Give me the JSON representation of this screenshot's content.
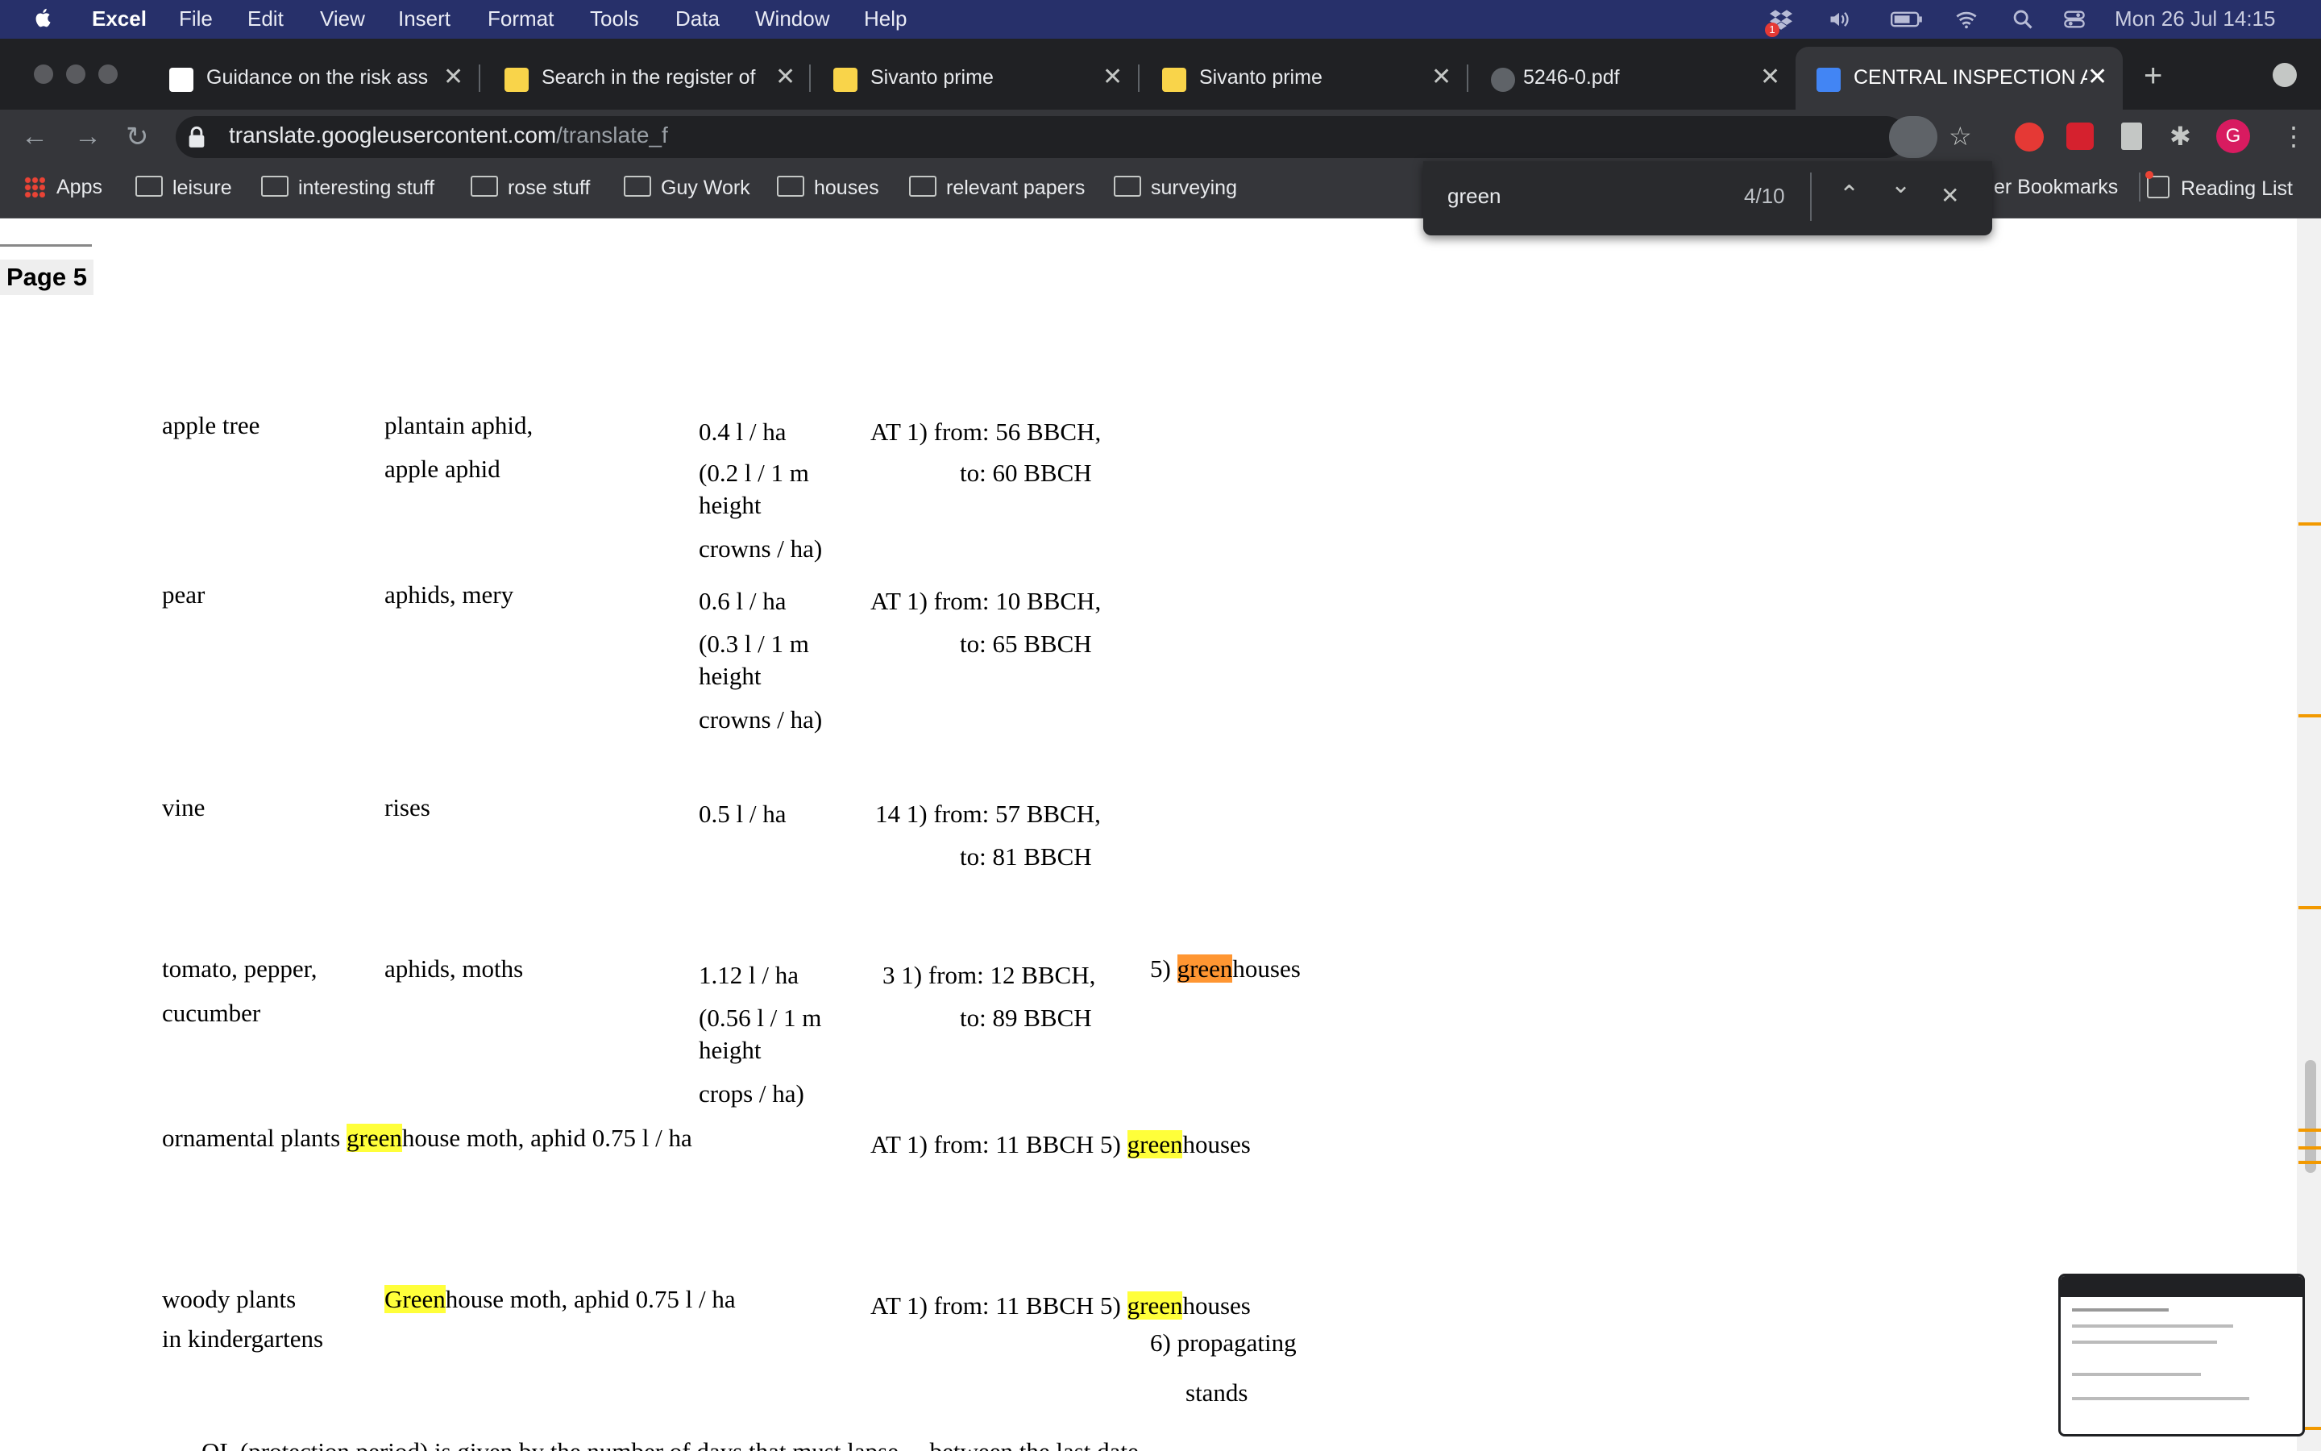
{
  "menubar": {
    "app": "Excel",
    "items": [
      "File",
      "Edit",
      "View",
      "Insert",
      "Format",
      "Tools",
      "Data",
      "Window",
      "Help"
    ],
    "clock": "Mon 26 Jul  14:15",
    "notification_badge": "1"
  },
  "tabs": [
    {
      "title": "Guidance on the risk ass",
      "active": false
    },
    {
      "title": "Search in the register of",
      "active": false
    },
    {
      "title": "Sivanto prime",
      "active": false
    },
    {
      "title": "Sivanto prime",
      "active": false
    },
    {
      "title": "5246-0.pdf",
      "active": false
    },
    {
      "title": "CENTRAL INSPECTION A",
      "active": true
    }
  ],
  "address": {
    "domain": "translate.googleusercontent.com",
    "path": "/translate_f"
  },
  "profile_initial": "G",
  "bookmarks": {
    "apps": "Apps",
    "folders": [
      "leisure",
      "interesting stuff",
      "rose stuff",
      "Guy Work",
      "houses",
      "relevant papers",
      "surveying"
    ],
    "other": "er Bookmarks",
    "reading_list": "Reading List"
  },
  "find": {
    "query": "green",
    "count": "4/10"
  },
  "document": {
    "page_label": "Page 5",
    "apple": {
      "crop": "apple tree",
      "pest1": "plantain aphid,",
      "pest2": "apple aphid",
      "dose1": "0.4 l / ha",
      "dose2": "(0.2 l / 1 m",
      "dose3": "height",
      "dose4": "crowns / ha)",
      "term1": "AT 1) from: 56 BBCH,",
      "term2": "to: 60 BBCH"
    },
    "pear": {
      "crop": "pear",
      "pest": "aphids, mery",
      "dose1": "0.6 l / ha",
      "dose2": "(0.3 l / 1 m",
      "dose3": "height",
      "dose4": "crowns / ha)",
      "term1": "AT 1) from: 10 BBCH,",
      "term2": "to: 65 BBCH"
    },
    "vine": {
      "crop": "vine",
      "pest": "rises",
      "dose": "0.5 l / ha",
      "term1": "14 1) from: 57 BBCH,",
      "term2": "to: 81 BBCH"
    },
    "tomato": {
      "crop1": "tomato, pepper,",
      "crop2": "cucumber",
      "pest": "aphids, moths",
      "dose1": "1.12 l / ha",
      "dose2": "(0.56 l / 1 m",
      "dose3": "height",
      "dose4": "crops / ha)",
      "term1": "3 1) from: 12 BBCH,",
      "term2": "to: 89 BBCH",
      "note_pre": "5) ",
      "note_hl": "green",
      "note_post": "houses"
    },
    "ornamental": {
      "pre": "ornamental plants ",
      "hl": "green",
      "post": "house moth, aphid 0.75 l / ha",
      "term": "AT 1) from: 11 BBCH 5) ",
      "term_hl": "green",
      "term_post": "houses"
    },
    "woody": {
      "crop1": "woody plants",
      "crop2": "in kindergartens",
      "pest_hl": "Green",
      "pest_post": "house moth, aphid 0.75 l / ha",
      "term": "AT 1) from: 11 BBCH 5) ",
      "term_hl": "green",
      "term_post": "houses",
      "note1": "6) propagating",
      "note2": "stands"
    },
    "footer_fragment": "OL (protection period) is given by the number of days that must lapse ... between the last date"
  }
}
